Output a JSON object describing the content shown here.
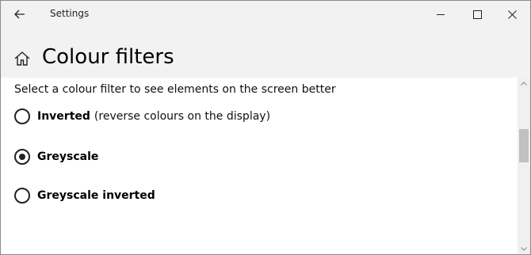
{
  "window": {
    "title": "Settings"
  },
  "header": {
    "title": "Colour filters"
  },
  "content": {
    "description": "Select a colour filter to see elements on the screen better",
    "options": [
      {
        "label": "Inverted",
        "sublabel": "(reverse colours on the display)",
        "selected": false
      },
      {
        "label": "Greyscale",
        "sublabel": "",
        "selected": true
      },
      {
        "label": "Greyscale inverted",
        "sublabel": "",
        "selected": false
      }
    ]
  },
  "icons": [
    "back-arrow-icon",
    "minimize-icon",
    "maximize-icon",
    "close-icon",
    "home-icon",
    "scroll-up-icon",
    "scroll-down-icon"
  ],
  "colors": {
    "chrome_bg": "#f2f2f2",
    "content_bg": "#ffffff",
    "radio": "#222222"
  }
}
